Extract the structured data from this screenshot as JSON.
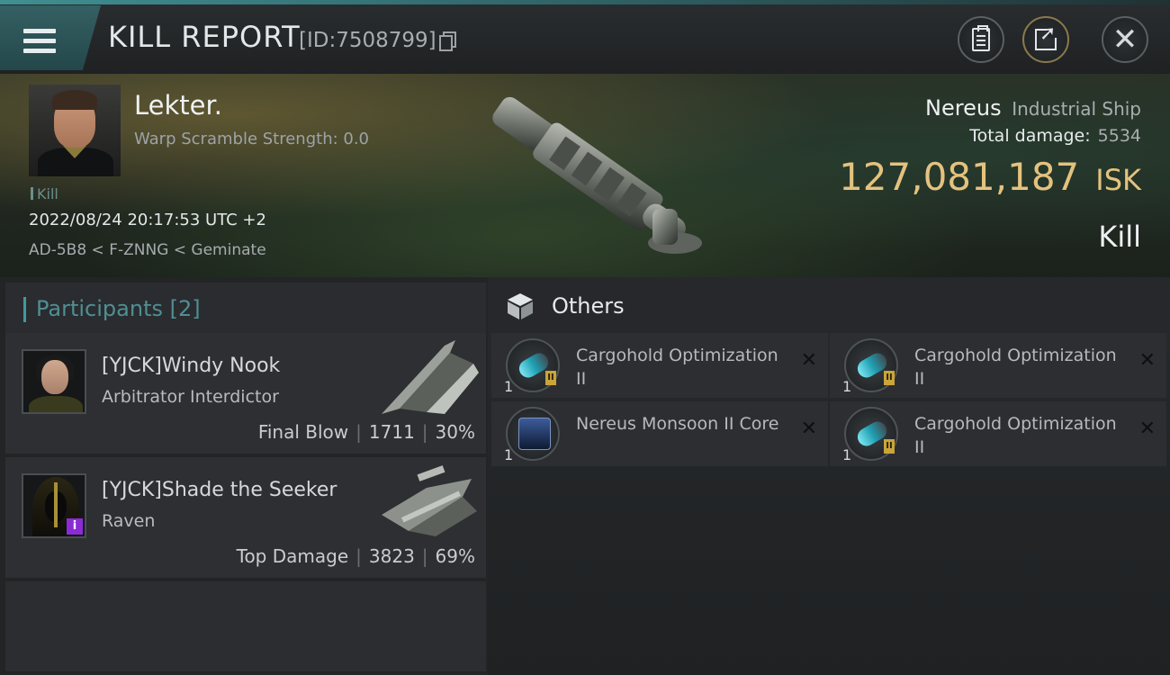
{
  "header": {
    "title": "KILL REPORT",
    "id_label": "[ID:7508799]"
  },
  "victim": {
    "name": "Lekter.",
    "warp_scramble": "Warp Scramble Strength: 0.0",
    "tag": "Kill",
    "timestamp": "2022/08/24 20:17:53 UTC +2",
    "location": "AD-5B8 < F-ZNNG < Geminate"
  },
  "ship": {
    "name": "Nereus",
    "class": "Industrial Ship",
    "total_damage_label": "Total damage:",
    "total_damage": "5534",
    "isk_value": "127,081,187",
    "isk_unit": "ISK",
    "result": "Kill"
  },
  "participants": {
    "header": "Participants [2]",
    "items": [
      {
        "name": "[YJCK]Windy Nook",
        "ship": "Arbitrator Interdictor",
        "role": "Final Blow",
        "damage": "1711",
        "percent": "30%"
      },
      {
        "name": "[YJCK]Shade the Seeker",
        "ship": "Raven",
        "role": "Top Damage",
        "damage": "3823",
        "percent": "69%",
        "badge": "i"
      }
    ]
  },
  "others": {
    "title": "Others",
    "items": [
      {
        "name": "Cargohold Optimization II",
        "qty": "1",
        "icon": "rig-icon"
      },
      {
        "name": "Cargohold Optimization II",
        "qty": "1",
        "icon": "rig-icon"
      },
      {
        "name": "Nereus Monsoon II Core",
        "qty": "1",
        "icon": "core-icon"
      },
      {
        "name": "Cargohold Optimization II",
        "qty": "1",
        "icon": "rig-icon"
      }
    ],
    "tech_badge": "II",
    "remove_symbol": "✕"
  },
  "colors": {
    "accent": "#3f9aa0",
    "isk": "#e4c27e",
    "badge_purple": "#8b2bd6"
  }
}
